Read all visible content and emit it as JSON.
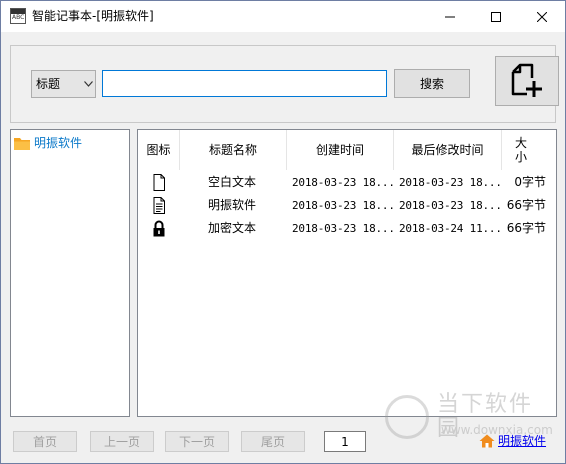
{
  "window": {
    "title": "智能记事本-[明振软件]"
  },
  "toolbar": {
    "search_field_selected": "标题",
    "search_value": "",
    "search_label": "搜索"
  },
  "tree": {
    "items": [
      {
        "label": "明振软件",
        "icon": "folder-icon"
      }
    ]
  },
  "list": {
    "columns": [
      "图标",
      "标题名称",
      "创建时间",
      "最后修改时间",
      "大\n小"
    ],
    "rows": [
      {
        "icon": "blank-document-icon",
        "name": "空白文本",
        "created": "2018-03-23 18...",
        "modified": "2018-03-23 18...",
        "size": "0字节"
      },
      {
        "icon": "text-document-icon",
        "name": "明振软件",
        "created": "2018-03-23 18...",
        "modified": "2018-03-23 18...",
        "size": "66字节"
      },
      {
        "icon": "lock-icon",
        "name": "加密文本",
        "created": "2018-03-23 18...",
        "modified": "2018-03-24 11...",
        "size": "66字节"
      }
    ]
  },
  "pager": {
    "first": "首页",
    "prev": "上一页",
    "next": "下一页",
    "last": "尾页",
    "page": "1"
  },
  "brand": {
    "label": "明振软件"
  },
  "watermark": {
    "cn": "当下软件园",
    "url": "www.downxia.com"
  },
  "colors": {
    "link": "#0b79c9",
    "folder": "#f6a623",
    "focus_border": "#0078d7"
  }
}
